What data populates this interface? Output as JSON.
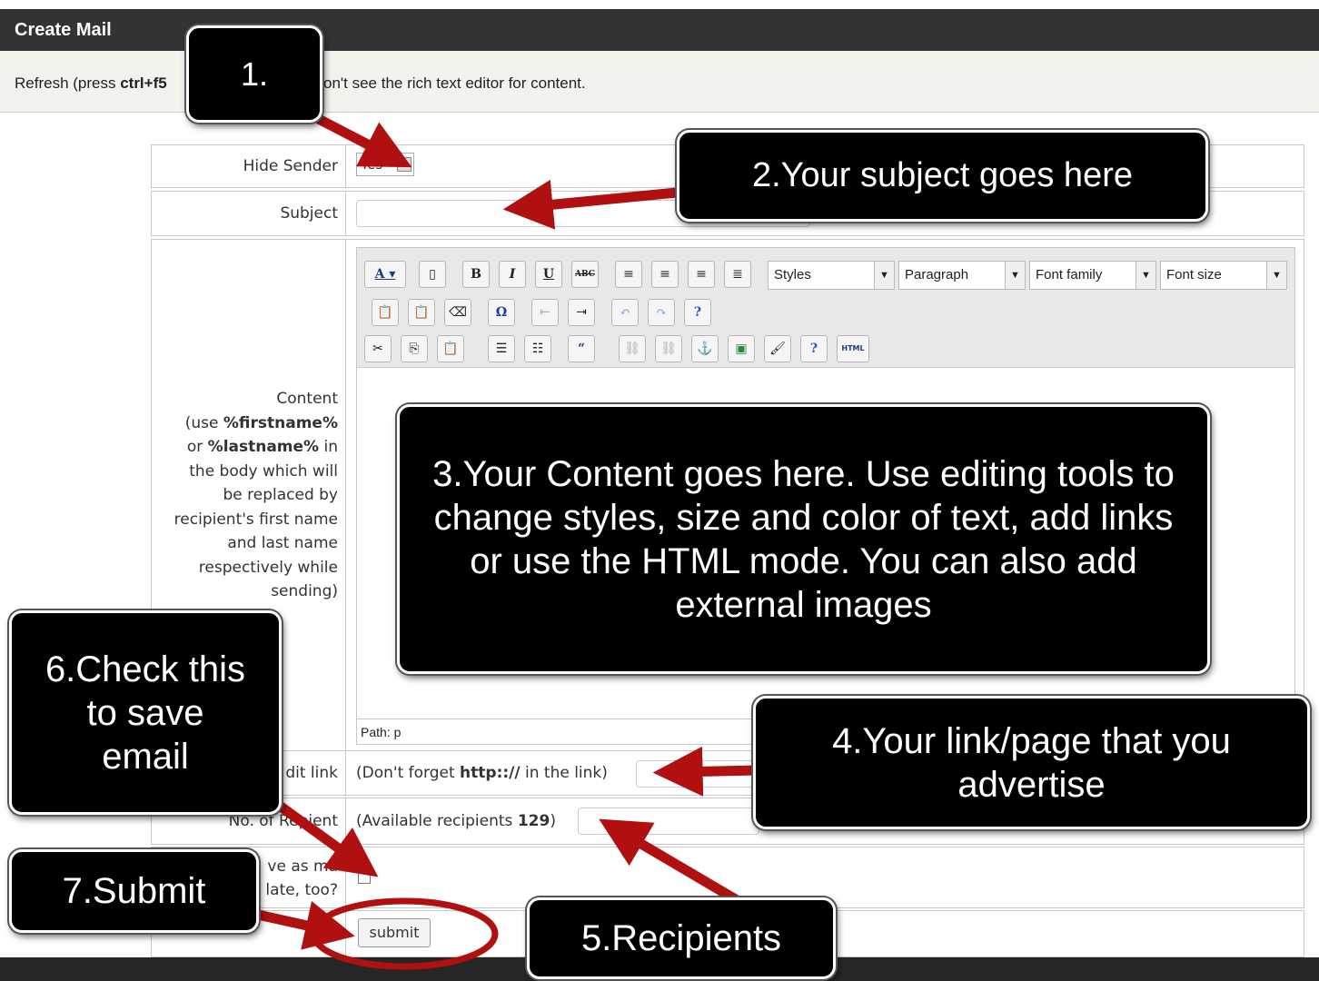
{
  "header": {
    "title": "Create Mail"
  },
  "note": {
    "part1": "Refresh (press ",
    "key": "ctrl+f5",
    "part2": "on't see the rich text editor for content."
  },
  "form": {
    "hide_sender": {
      "label": "Hide Sender",
      "value": "Yes"
    },
    "subject": {
      "label": "Subject",
      "value": ""
    },
    "content": {
      "label_line1": "Content",
      "label_line2a": "(use ",
      "label_firstname": "%firstname%",
      "label_line3a": "or ",
      "label_lastname": "%lastname%",
      "label_line3b": " in",
      "label_line4": "the body which will",
      "label_line5": "be replaced by",
      "label_line6": "recipient's first name",
      "label_line7": "and last name",
      "label_line8": "respectively while",
      "label_line9": "sending)"
    },
    "editor": {
      "styles": "Styles",
      "paragraph": "Paragraph",
      "font_family": "Font family",
      "font_size": "Font size",
      "path": "Path: p"
    },
    "credit_link": {
      "label": "dit link",
      "hint1": "(Don't forget ",
      "hint_bold": "http:://",
      "hint2": " in the link)"
    },
    "recipients": {
      "label": "No. of Re",
      "label_tail": "pient",
      "hint1": "(Available recipients ",
      "count": "129",
      "hint2": ")"
    },
    "save_template": {
      "label_line1": "ve as ma",
      "label_line2": "late, too?"
    },
    "submit": {
      "label": "submit"
    }
  },
  "callouts": {
    "c1": "1.",
    "c2": "2.Your subject goes here",
    "c3": "3.Your Content goes here. Use editing tools to change styles, size and color of text, add links or use the HTML mode. You can also add external images",
    "c4": "4.Your link/page that you advertise",
    "c5": "5.Recipients",
    "c6": "6.Check this to save email",
    "c7": "7.Submit"
  },
  "colors": {
    "arrow": "#b01010",
    "callout_bg": "#000000",
    "header_bg": "#333333"
  }
}
